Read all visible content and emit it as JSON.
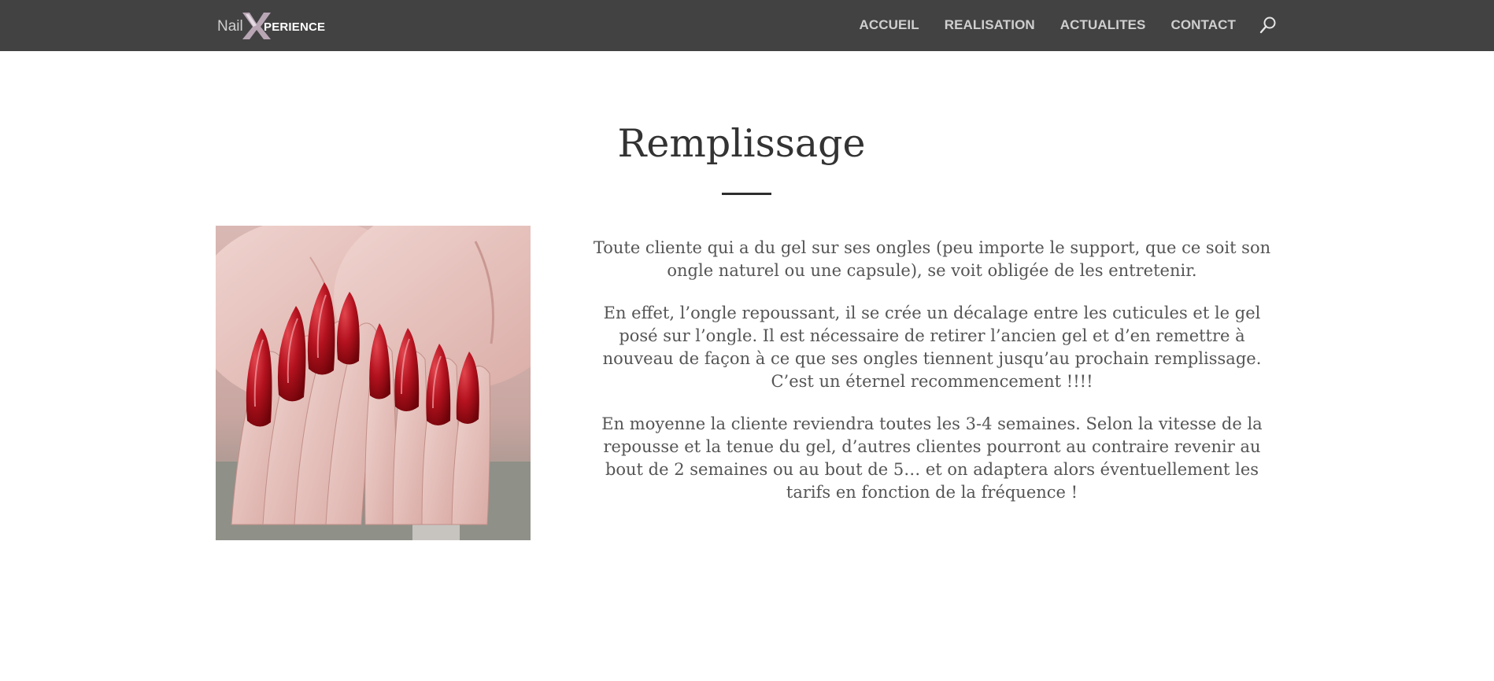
{
  "header": {
    "logo_text": "NailXPERIENCE",
    "background_color": "#424242",
    "nav": [
      {
        "label": "ACCUEIL"
      },
      {
        "label": "REALISATION"
      },
      {
        "label": "ACTUALITES"
      },
      {
        "label": "CONTACT"
      }
    ],
    "search_icon": "search-icon"
  },
  "main": {
    "title": "Remplissage",
    "image_subject": "manicured-hands-red-almond-nails",
    "paragraphs": [
      "Toute cliente qui a du gel sur ses ongles (peu importe le support, que ce soit son ongle naturel ou une capsule), se voit obligée de les entretenir.",
      "En effet, l’ongle repoussant, il se crée un décalage entre les cuticules et le gel posé sur l’ongle. Il est nécessaire de retirer l’ancien gel et d’en remettre à nouveau de façon à ce que ses ongles tiennent jusqu’au prochain remplissage. C’est un éternel recommencement !!!!",
      "En moyenne la cliente reviendra toutes les 3-4 semaines. Selon la vitesse de la repousse et la tenue du gel, d’autres clientes pourront au contraire revenir au bout de 2 semaines ou au bout de 5… et on adaptera alors éventuellement les tarifs en fonction de la fréquence !"
    ]
  }
}
